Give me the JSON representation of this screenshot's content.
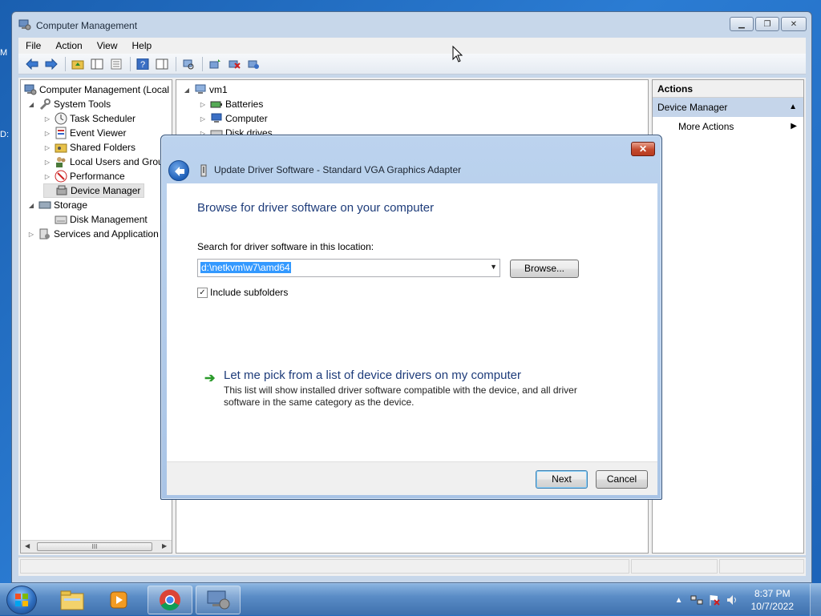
{
  "desktop": {
    "edge_letter_1": "M",
    "edge_letter_2": "D:"
  },
  "window": {
    "title": "Computer Management",
    "menu": [
      "File",
      "Action",
      "View",
      "Help"
    ]
  },
  "tree": {
    "items": [
      {
        "label": "Computer Management (Local",
        "icon": "computer-management-icon",
        "expander": ""
      },
      {
        "label": "System Tools",
        "icon": "system-tools-icon",
        "expander": "◢"
      },
      {
        "label": "Task Scheduler",
        "icon": "clock-icon",
        "expander": "▷"
      },
      {
        "label": "Event Viewer",
        "icon": "event-viewer-icon",
        "expander": "▷"
      },
      {
        "label": "Shared Folders",
        "icon": "shared-folders-icon",
        "expander": "▷"
      },
      {
        "label": "Local Users and Grou",
        "icon": "users-icon",
        "expander": "▷"
      },
      {
        "label": "Performance",
        "icon": "performance-icon",
        "expander": "▷"
      },
      {
        "label": "Device Manager",
        "icon": "device-manager-icon",
        "expander": ""
      },
      {
        "label": "Storage",
        "icon": "storage-icon",
        "expander": "◢"
      },
      {
        "label": "Disk Management",
        "icon": "disk-icon",
        "expander": ""
      },
      {
        "label": "Services and Application",
        "icon": "services-icon",
        "expander": "▷"
      }
    ],
    "scroll_thumb_label": "III"
  },
  "devices": {
    "root": "vm1",
    "items": [
      "Batteries",
      "Computer",
      "Disk drives"
    ]
  },
  "actions": {
    "header": "Actions",
    "selected": "Device Manager",
    "more": "More Actions"
  },
  "dialog": {
    "title": "Update Driver Software - Standard VGA Graphics Adapter",
    "close_label": "✕",
    "heading": "Browse for driver software on your computer",
    "search_label": "Search for driver software in this location:",
    "path_value": "d:\\netkvm\\w7\\amd64",
    "browse_label": "Browse...",
    "include_subfolders_label": "Include subfolders",
    "include_subfolders_checked": true,
    "pick_title": "Let me pick from a list of device drivers on my computer",
    "pick_desc": "This list will show installed driver software compatible with the device, and all driver software in the same category as the device.",
    "next_label": "Next",
    "cancel_label": "Cancel"
  },
  "taskbar": {
    "apps": [
      "file-explorer-icon",
      "media-player-icon",
      "chrome-icon",
      "computer-management-app-icon"
    ],
    "active_app": "computer-management-app-icon",
    "tray_show_hidden": "▲",
    "time": "8:37 PM",
    "date": "10/7/2022"
  },
  "colors": {
    "accent": "#1e3c7a",
    "selection": "#3399ff",
    "actions_selected": "#c5d5ea"
  }
}
